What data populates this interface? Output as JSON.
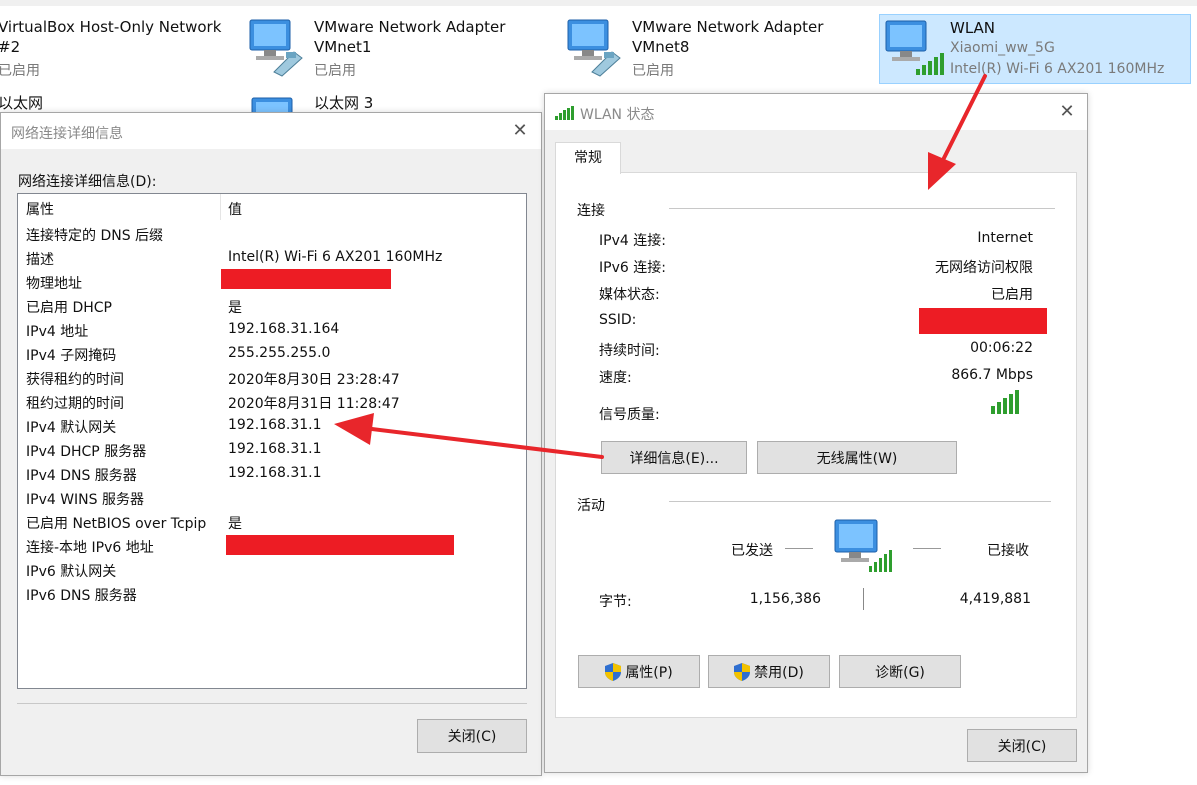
{
  "adapters": {
    "vbox": {
      "name": "VirtualBox Host-Only Network",
      "line2": "#2",
      "status": "已启用"
    },
    "vmnet1": {
      "name": "VMware Network Adapter",
      "line2": "VMnet1",
      "status": "已启用"
    },
    "vmnet8": {
      "name": "VMware Network Adapter",
      "line2": "VMnet8",
      "status": "已启用"
    },
    "wlan": {
      "name": "WLAN",
      "ssid": "Xiaomi_ww_5G",
      "device": "Intel(R) Wi-Fi 6 AX201 160MHz"
    },
    "ethernet": {
      "name": "以太网"
    },
    "ethernet3": {
      "name": "以太网 3"
    }
  },
  "details_dialog": {
    "title": "网络连接详细信息",
    "list_label": "网络连接详细信息(D):",
    "columns": {
      "property": "属性",
      "value": "值"
    },
    "rows": [
      {
        "property": "连接特定的 DNS 后缀",
        "value": ""
      },
      {
        "property": "描述",
        "value": "Intel(R) Wi-Fi 6 AX201 160MHz"
      },
      {
        "property": "物理地址",
        "value": ""
      },
      {
        "property": "已启用 DHCP",
        "value": "是"
      },
      {
        "property": "IPv4 地址",
        "value": "192.168.31.164"
      },
      {
        "property": "IPv4 子网掩码",
        "value": "255.255.255.0"
      },
      {
        "property": "获得租约的时间",
        "value": "2020年8月30日 23:28:47"
      },
      {
        "property": "租约过期的时间",
        "value": "2020年8月31日 11:28:47"
      },
      {
        "property": "IPv4 默认网关",
        "value": "192.168.31.1"
      },
      {
        "property": "IPv4 DHCP 服务器",
        "value": "192.168.31.1"
      },
      {
        "property": "IPv4 DNS 服务器",
        "value": "192.168.31.1"
      },
      {
        "property": "IPv4 WINS 服务器",
        "value": ""
      },
      {
        "property": "已启用 NetBIOS over Tcpip",
        "value": "是"
      },
      {
        "property": "连接-本地 IPv6 地址",
        "value": ""
      },
      {
        "property": "IPv6 默认网关",
        "value": ""
      },
      {
        "property": "IPv6 DNS 服务器",
        "value": ""
      }
    ],
    "close_label": "关闭(C)"
  },
  "status_dialog": {
    "title": "WLAN 状态",
    "tab": "常规",
    "connection_group": "连接",
    "fields": {
      "ipv4_label": "IPv4 连接:",
      "ipv4_value": "Internet",
      "ipv6_label": "IPv6 连接:",
      "ipv6_value": "无网络访问权限",
      "media_label": "媒体状态:",
      "media_value": "已启用",
      "ssid_label": "SSID:",
      "duration_label": "持续时间:",
      "duration_value": "00:06:22",
      "speed_label": "速度:",
      "speed_value": "866.7 Mbps",
      "signal_label": "信号质量:"
    },
    "details_button": "详细信息(E)...",
    "wireless_button": "无线属性(W)",
    "activity_group": "活动",
    "sent_label": "已发送",
    "received_label": "已接收",
    "bytes_label": "字节:",
    "bytes_sent": "1,156,386",
    "bytes_received": "4,419,881",
    "properties_button": "属性(P)",
    "disable_button": "禁用(D)",
    "diagnose_button": "诊断(G)",
    "close_label": "关闭(C)"
  },
  "colors": {
    "redaction": "#ed1c24",
    "arrow": "#e8262b",
    "selection": "#cce8ff",
    "signal": "#2e9e2e"
  }
}
